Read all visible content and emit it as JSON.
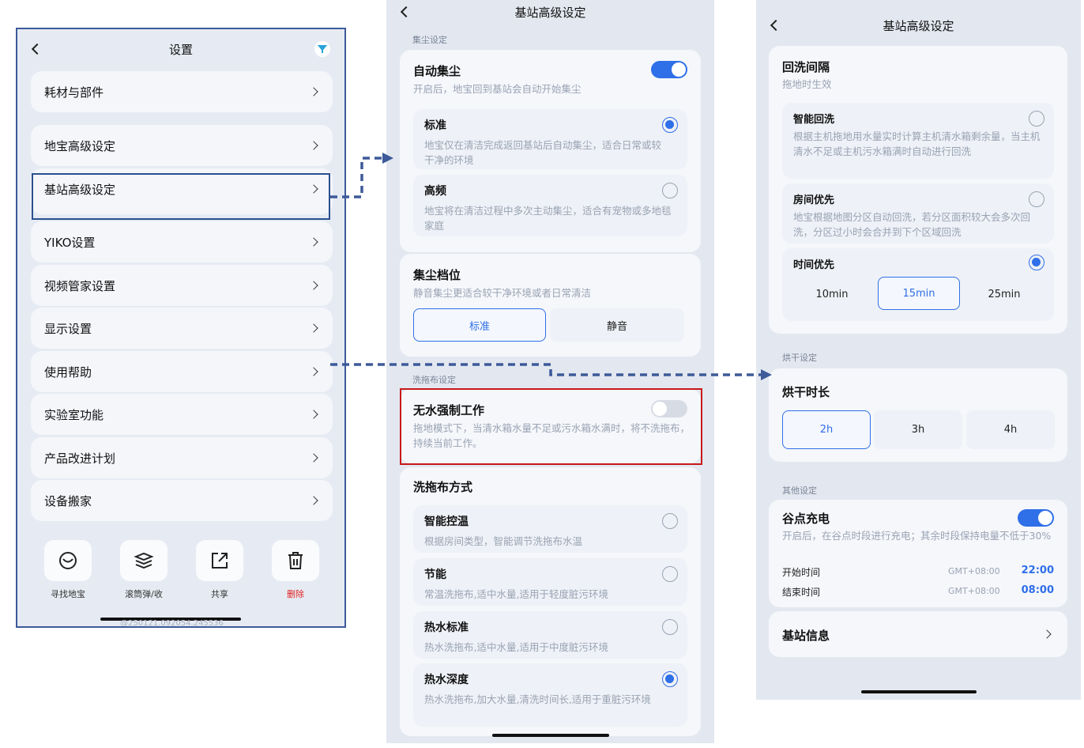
{
  "left": {
    "title": "设置",
    "items": [
      "耗材与部件",
      "地宝高级设定",
      "基站高级设定",
      "YIKO设置",
      "视频管家设置",
      "显示设置",
      "使用帮助",
      "实验室功能",
      "产品改进计划",
      "设备搬家"
    ],
    "actions": [
      {
        "label": "寻找地宝",
        "icon": "locate-icon"
      },
      {
        "label": "滚筒弹/收",
        "icon": "roller-icon"
      },
      {
        "label": "共享",
        "icon": "share-icon"
      },
      {
        "label": "删除",
        "icon": "trash-icon"
      }
    ],
    "watermark": "@250121.092054.245536"
  },
  "middle": {
    "title": "基站高级设定",
    "section_dust": "集尘设定",
    "auto_dust": {
      "title": "自动集尘",
      "desc": "开启后，地宝回到基站会自动开始集尘",
      "on": true
    },
    "dust_modes": [
      {
        "title": "标准",
        "desc": "地宝仅在清洁完成返回基站后自动集尘，适合日常或较干净的环境",
        "selected": true
      },
      {
        "title": "高频",
        "desc": "地宝将在清洁过程中多次主动集尘，适合有宠物或多地毯家庭",
        "selected": false
      }
    ],
    "dust_level": {
      "title": "集尘档位",
      "desc": "静音集尘更适合较干净环境或者日常清洁",
      "options": [
        "标准",
        "静音"
      ],
      "selected": 0
    },
    "section_wash": "洗拖布设定",
    "waterless": {
      "title": "无水强制工作",
      "desc": "拖地模式下，当清水箱水量不足或污水箱水满时，将不洗拖布，持续当前工作。",
      "on": false
    },
    "wash_mode": {
      "title": "洗拖布方式",
      "options": [
        {
          "title": "智能控温",
          "desc": "根据房间类型，智能调节洗拖布水温",
          "selected": false
        },
        {
          "title": "节能",
          "desc": "常温洗拖布,适中水量,适用于轻度脏污环境",
          "selected": false
        },
        {
          "title": "热水标准",
          "desc": "热水洗拖布,适中水量,适用于中度脏污环境",
          "selected": false
        },
        {
          "title": "热水深度",
          "desc": "热水洗拖布,加大水量,清洗时间长,适用于重脏污环境",
          "selected": true
        }
      ]
    }
  },
  "right": {
    "title": "基站高级设定",
    "rewash": {
      "title": "回洗间隔",
      "desc": "拖地时生效",
      "options": [
        {
          "title": "智能回洗",
          "desc": "根据主机拖地用水量实时计算主机清水箱剩余量，当主机清水不足或主机污水箱满时自动进行回洗",
          "selected": false
        },
        {
          "title": "房间优先",
          "desc": "地宝根据地图分区自动回洗，若分区面积较大会多次回洗，分区过小时会合并到下个区域回洗",
          "selected": false
        },
        {
          "title": "时间优先",
          "desc": "",
          "selected": true
        }
      ],
      "times": [
        "10min",
        "15min",
        "25min"
      ],
      "time_selected": 1
    },
    "section_dry": "烘干设定",
    "dry": {
      "title": "烘干时长",
      "options": [
        "2h",
        "3h",
        "4h"
      ],
      "selected": 0
    },
    "section_other": "其他设定",
    "valley": {
      "title": "谷点充电",
      "desc": "开启后，在谷点时段进行充电；其余时段保持电量不低于30%",
      "on": true,
      "start_label": "开始时间",
      "start_tz": "GMT+08:00",
      "start_time": "22:00",
      "end_label": "结束时间",
      "end_tz": "GMT+08:00",
      "end_time": "08:00"
    },
    "station_info": "基站信息"
  },
  "colors": {
    "accent": "#2f6fe8",
    "highlight_blue": "#2a4f8f",
    "highlight_red": "#c81818",
    "danger": "#e02020"
  }
}
